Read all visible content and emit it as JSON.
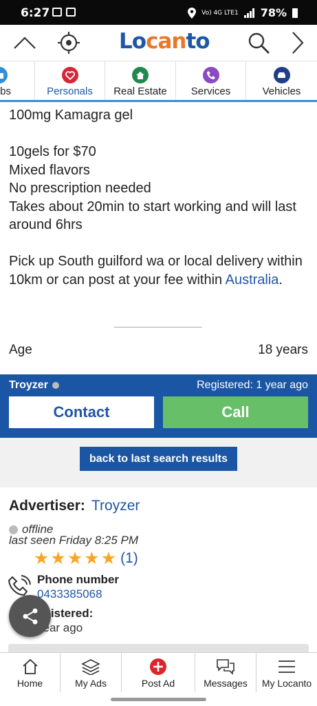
{
  "status_bar": {
    "time": "6:27",
    "network": "Vo) 4G LTE1",
    "battery": "78%"
  },
  "header": {
    "logo": "Locanto",
    "icons": [
      "chevron-up-icon",
      "locate-icon",
      "search-icon",
      "chevron-right-icon"
    ]
  },
  "categories": [
    {
      "label": "bs",
      "icon": "jobs-icon",
      "color": "#2f8fd8"
    },
    {
      "label": "Personals",
      "icon": "heart-icon",
      "color": "#d6263a",
      "active": true
    },
    {
      "label": "Real Estate",
      "icon": "house-icon",
      "color": "#1f8a4c"
    },
    {
      "label": "Services",
      "icon": "phone-icon",
      "color": "#8a4bc2"
    },
    {
      "label": "Vehicles",
      "icon": "car-icon",
      "color": "#1f3f86"
    }
  ],
  "ad": {
    "description_main": "100mg Kamagra gel\n\n10gels for $70\nMixed flavors\nNo prescription needed\nTakes about 20min to start working and will last around 6hrs\n\nPick up South guilford wa or local delivery within 10km or can post at your fee within ",
    "description_link": "Australia",
    "description_end": ".",
    "age_label": "Age",
    "age_value": "18 years"
  },
  "contact": {
    "username": "Troyzer",
    "registered": "Registered: 1 year ago",
    "contact_label": "Contact",
    "call_label": "Call",
    "back_label": "back to last search results"
  },
  "advertiser": {
    "label": "Advertiser:",
    "name": "Troyzer",
    "status": "offline",
    "last_seen": "last seen Friday 8:25 PM",
    "rating": 5,
    "rating_count": "(1)",
    "phone_label": "Phone number",
    "phone": "0433385068",
    "registered_label": "egistered:",
    "registered_value": "year ago"
  },
  "bottom_nav": [
    {
      "label": "Home",
      "icon": "home-icon"
    },
    {
      "label": "My Ads",
      "icon": "stack-icon"
    },
    {
      "label": "Post Ad",
      "icon": "plus-circle-icon"
    },
    {
      "label": "Messages",
      "icon": "messages-icon"
    },
    {
      "label": "My Locanto",
      "icon": "menu-icon"
    }
  ],
  "colors": {
    "brand_blue": "#1a56a3",
    "call_green": "#67bf67",
    "star": "#f6a623",
    "logo_orange": "#e8782a"
  }
}
